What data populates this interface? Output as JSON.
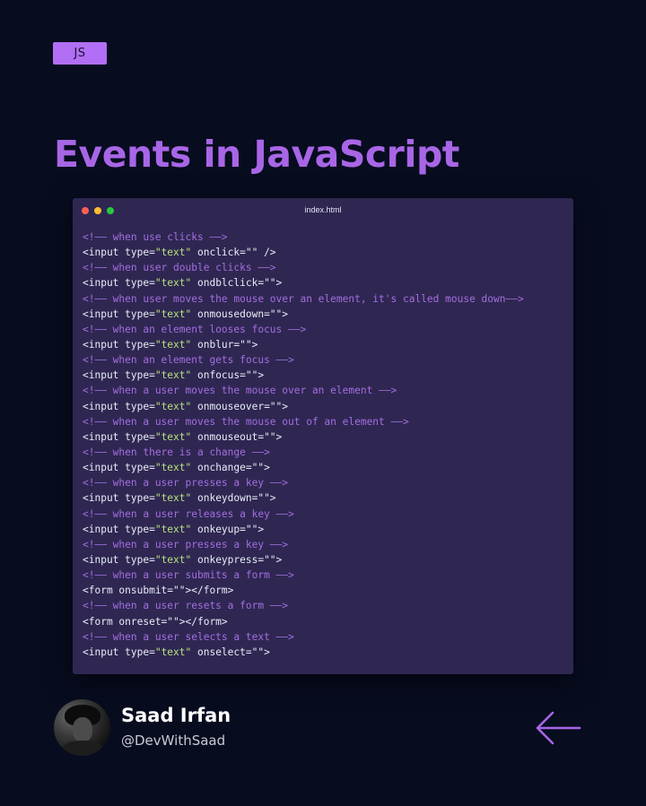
{
  "badge": "JS",
  "title": "Events in JavaScript",
  "editor": {
    "filename": "index.html",
    "lines": [
      {
        "type": "comment",
        "text": "<!—— when use clicks ——>"
      },
      {
        "type": "code",
        "pre": "<input type=",
        "str": "\"text\"",
        "post": " onclick=\"\" />"
      },
      {
        "type": "comment",
        "text": "<!—— when user double clicks ——>"
      },
      {
        "type": "code",
        "pre": "<input type=",
        "str": "\"text\"",
        "post": " ondblclick=\"\">"
      },
      {
        "type": "comment",
        "text": "<!—— when user moves the mouse over an element, it's called mouse down——>"
      },
      {
        "type": "code",
        "pre": "<input type=",
        "str": "\"text\"",
        "post": " onmousedown=\"\">"
      },
      {
        "type": "comment",
        "text": "<!—— when an element looses focus ——>"
      },
      {
        "type": "code",
        "pre": "<input type=",
        "str": "\"text\"",
        "post": " onblur=\"\">"
      },
      {
        "type": "comment",
        "text": "<!—— when an element gets focus ——>"
      },
      {
        "type": "code",
        "pre": "<input type=",
        "str": "\"text\"",
        "post": " onfocus=\"\">"
      },
      {
        "type": "comment",
        "text": "<!—— when a user moves the mouse over an element ——>"
      },
      {
        "type": "code",
        "pre": "<input type=",
        "str": "\"text\"",
        "post": " onmouseover=\"\">"
      },
      {
        "type": "comment",
        "text": "<!—— when a user moves the mouse out of an element ——>"
      },
      {
        "type": "code",
        "pre": "<input type=",
        "str": "\"text\"",
        "post": " onmouseout=\"\">"
      },
      {
        "type": "comment",
        "text": "<!—— when there is a change ——>"
      },
      {
        "type": "code",
        "pre": "<input type=",
        "str": "\"text\"",
        "post": " onchange=\"\">"
      },
      {
        "type": "comment",
        "text": "<!—— when a user presses a key ——>"
      },
      {
        "type": "code",
        "pre": "<input type=",
        "str": "\"text\"",
        "post": " onkeydown=\"\">"
      },
      {
        "type": "comment",
        "text": "<!—— when a user releases a key ——>"
      },
      {
        "type": "code",
        "pre": "<input type=",
        "str": "\"text\"",
        "post": " onkeyup=\"\">"
      },
      {
        "type": "comment",
        "text": "<!—— when a user presses a key ——>"
      },
      {
        "type": "code",
        "pre": "<input type=",
        "str": "\"text\"",
        "post": " onkeypress=\"\">"
      },
      {
        "type": "comment",
        "text": "<!—— when a user submits a form ——>"
      },
      {
        "type": "code",
        "pre": "<form onsubmit=\"\"></form>",
        "str": "",
        "post": ""
      },
      {
        "type": "comment",
        "text": "<!—— when a user resets a form ——>"
      },
      {
        "type": "code",
        "pre": "<form onreset=\"\"></form>",
        "str": "",
        "post": ""
      },
      {
        "type": "comment",
        "text": "<!—— when a user selects a text ——>"
      },
      {
        "type": "code",
        "pre": "<input type=",
        "str": "\"text\"",
        "post": " onselect=\"\">"
      }
    ]
  },
  "author": {
    "name": "Saad Irfan",
    "handle": "@DevWithSaad"
  },
  "icons": {
    "back": "arrow-left-icon"
  },
  "colors": {
    "background": "#070c1f",
    "accent": "#a866e6",
    "editor_bg": "#2f2752",
    "comment": "#a36ee0",
    "string": "#b7e27d"
  }
}
